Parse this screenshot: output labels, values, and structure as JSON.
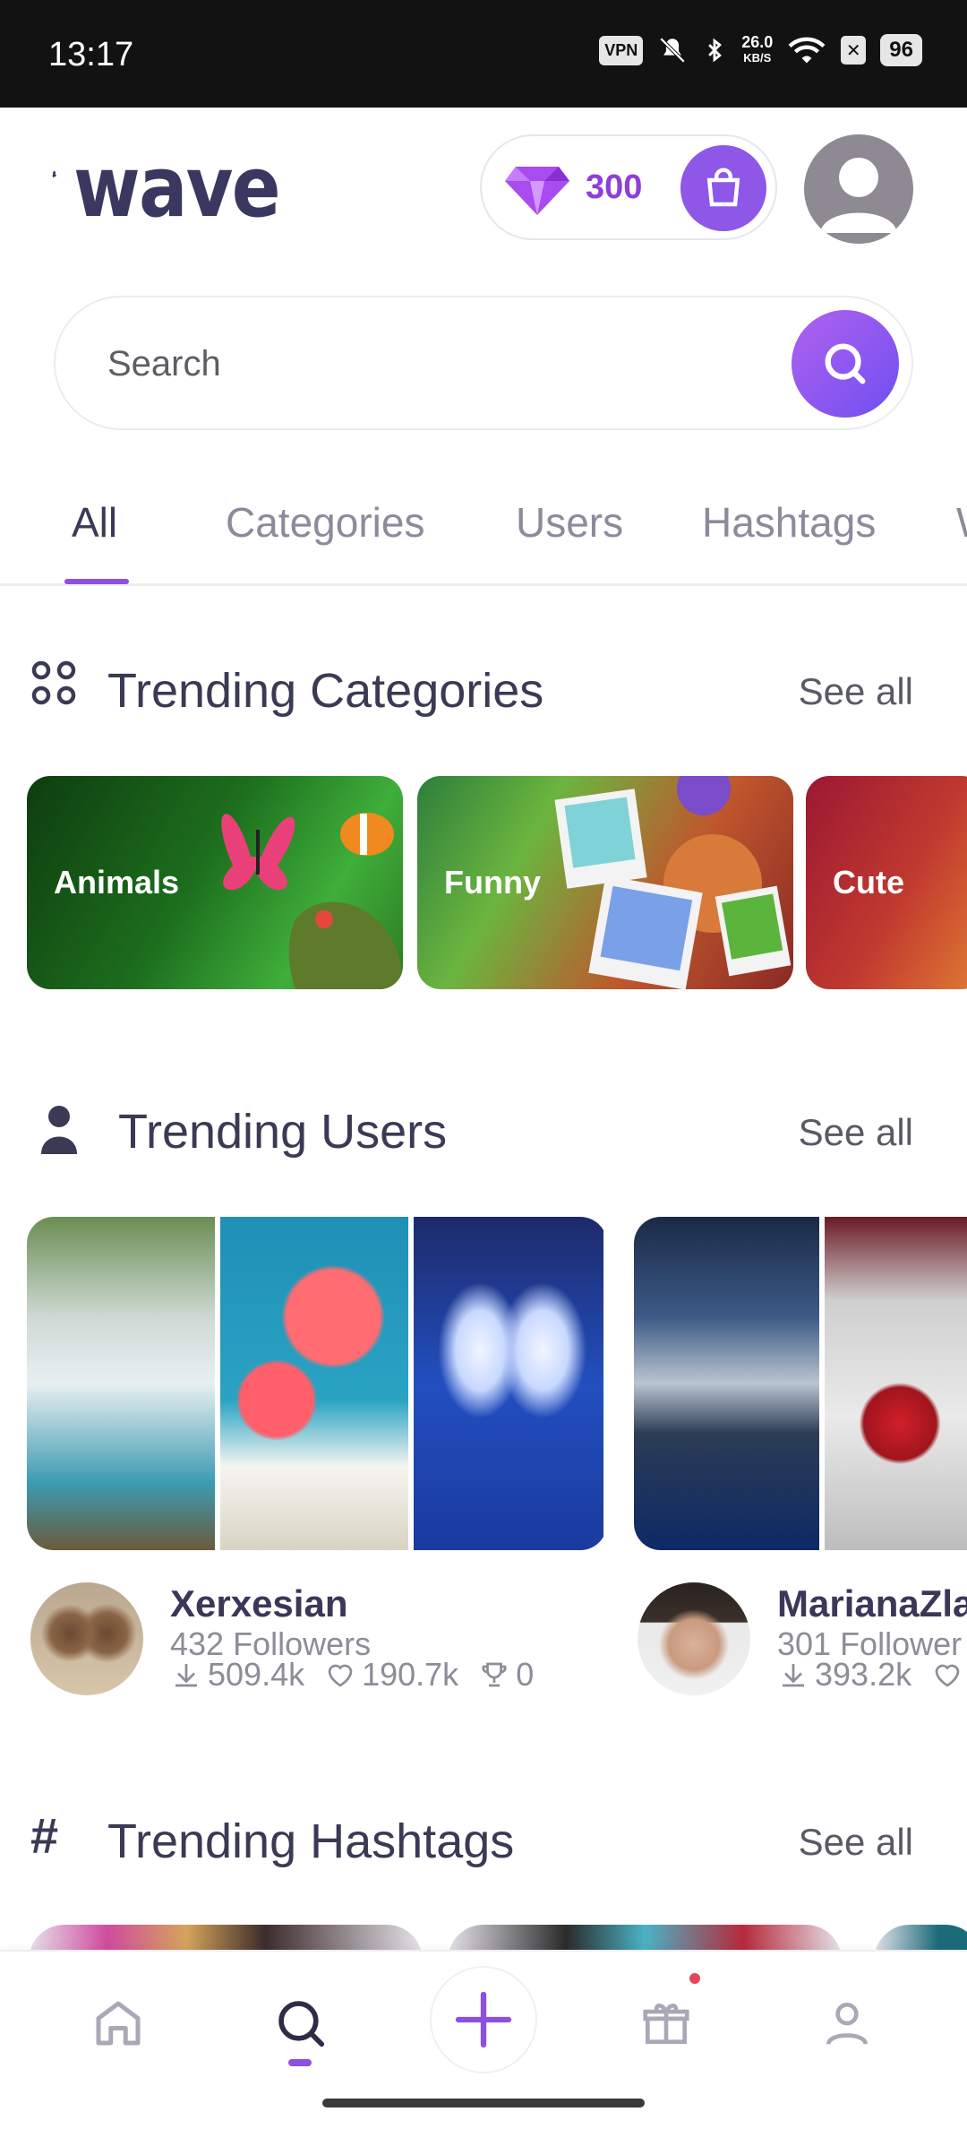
{
  "status_bar": {
    "time": "13:17",
    "vpn": "VPN",
    "net_speed": "26.0",
    "net_unit": "KB/S",
    "battery": "96"
  },
  "header": {
    "app_name": "wave",
    "gems": "300",
    "icons": [
      "gem-icon",
      "shopping-bag-icon",
      "profile-avatar"
    ]
  },
  "search": {
    "placeholder": "Search"
  },
  "tabs": [
    {
      "label": "All",
      "active": true
    },
    {
      "label": "Categories",
      "active": false
    },
    {
      "label": "Users",
      "active": false
    },
    {
      "label": "Hashtags",
      "active": false
    },
    {
      "label": "W",
      "active": false
    }
  ],
  "trending_categories": {
    "title": "Trending Categories",
    "see_all": "See all",
    "items": [
      {
        "label": "Animals"
      },
      {
        "label": "Funny"
      },
      {
        "label": "Cute"
      }
    ]
  },
  "trending_users": {
    "title": "Trending Users",
    "see_all": "See all",
    "users": [
      {
        "name": "Xerxesian",
        "followers": "432 Followers",
        "downloads": "509.4k",
        "likes": "190.7k",
        "trophies": "0"
      },
      {
        "name": "MarianaZla",
        "followers": "301 Follower",
        "downloads": "393.2k",
        "likes": "",
        "trophies": ""
      }
    ]
  },
  "trending_hashtags": {
    "title": "Trending Hashtags",
    "see_all": "See all"
  },
  "bottom_nav": {
    "items": [
      "home-icon",
      "search-icon",
      "plus-icon",
      "gift-icon",
      "profile-icon"
    ],
    "active": "search-icon",
    "accent": "#8d4fe0"
  }
}
